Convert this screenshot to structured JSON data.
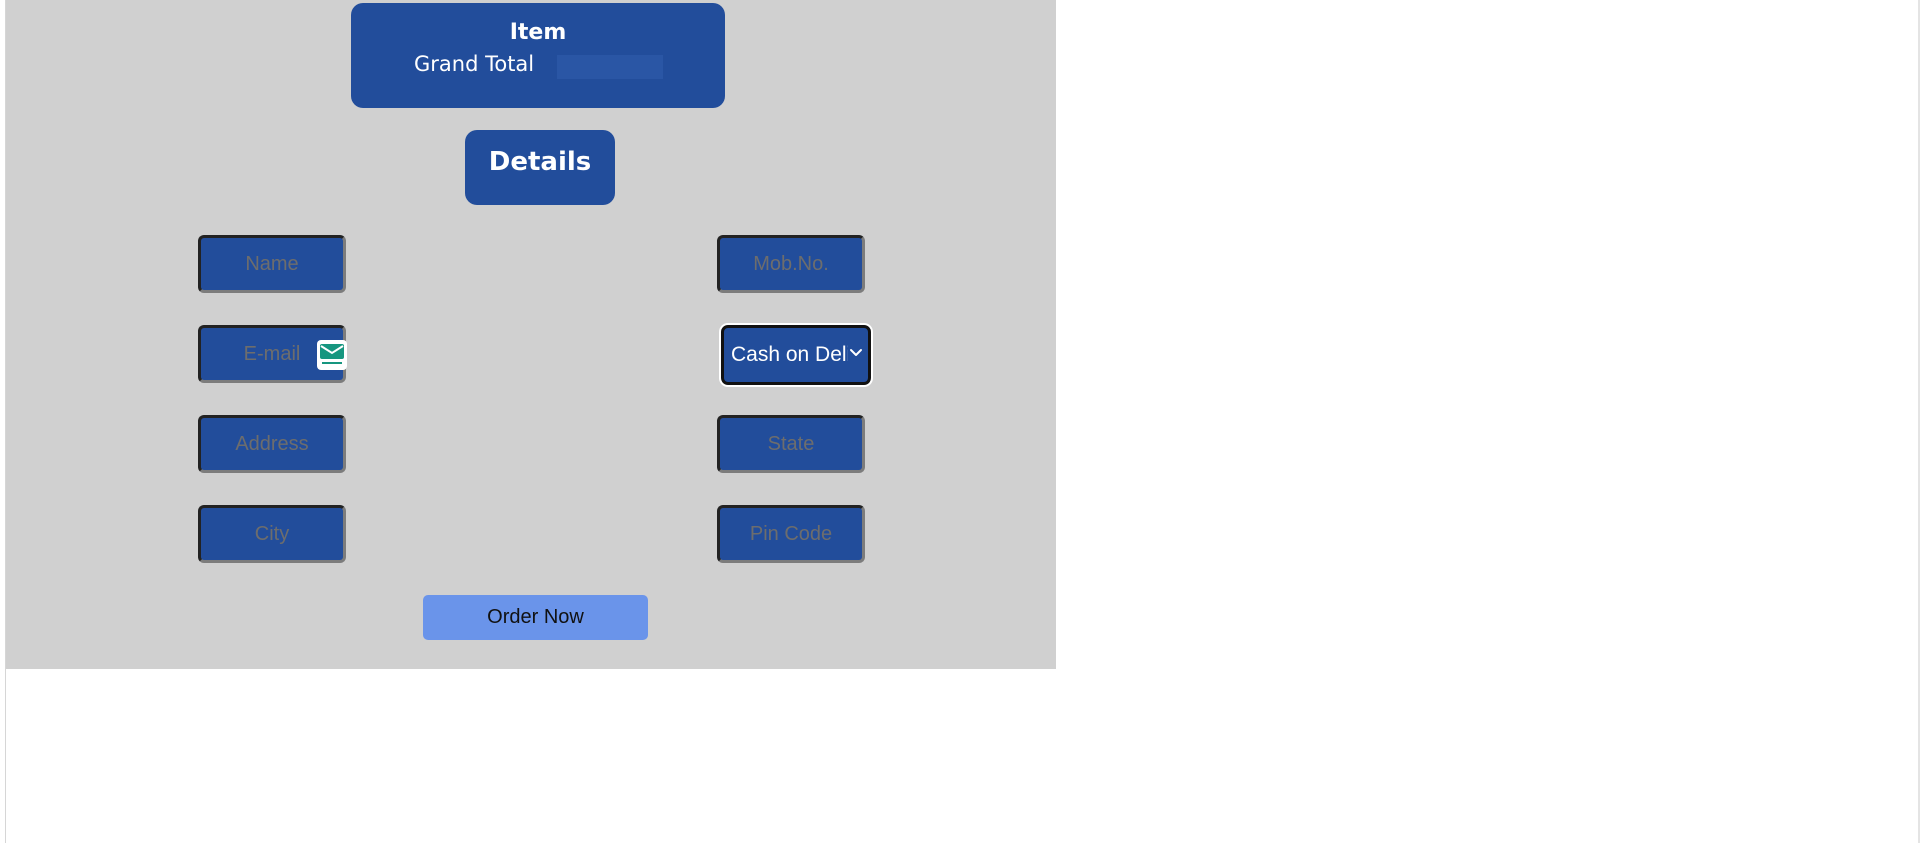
{
  "summary": {
    "title": "Item",
    "grand_total_label": "Grand Total",
    "grand_total_value": ""
  },
  "details": {
    "heading": "Details"
  },
  "form": {
    "name_placeholder": "Name",
    "mobile_placeholder": "Mob.No.",
    "email_placeholder": "E-mail",
    "address_placeholder": "Address",
    "state_placeholder": "State",
    "city_placeholder": "City",
    "pin_code_placeholder": "Pin Code",
    "payment_method": {
      "selected": "Cash on Delivery"
    },
    "email_badge_icon": "mail-icon"
  },
  "actions": {
    "order_label": "Order Now"
  },
  "colors": {
    "panel": "#d0d0d0",
    "accent": "#224d9b",
    "button": "#6a94ea"
  }
}
